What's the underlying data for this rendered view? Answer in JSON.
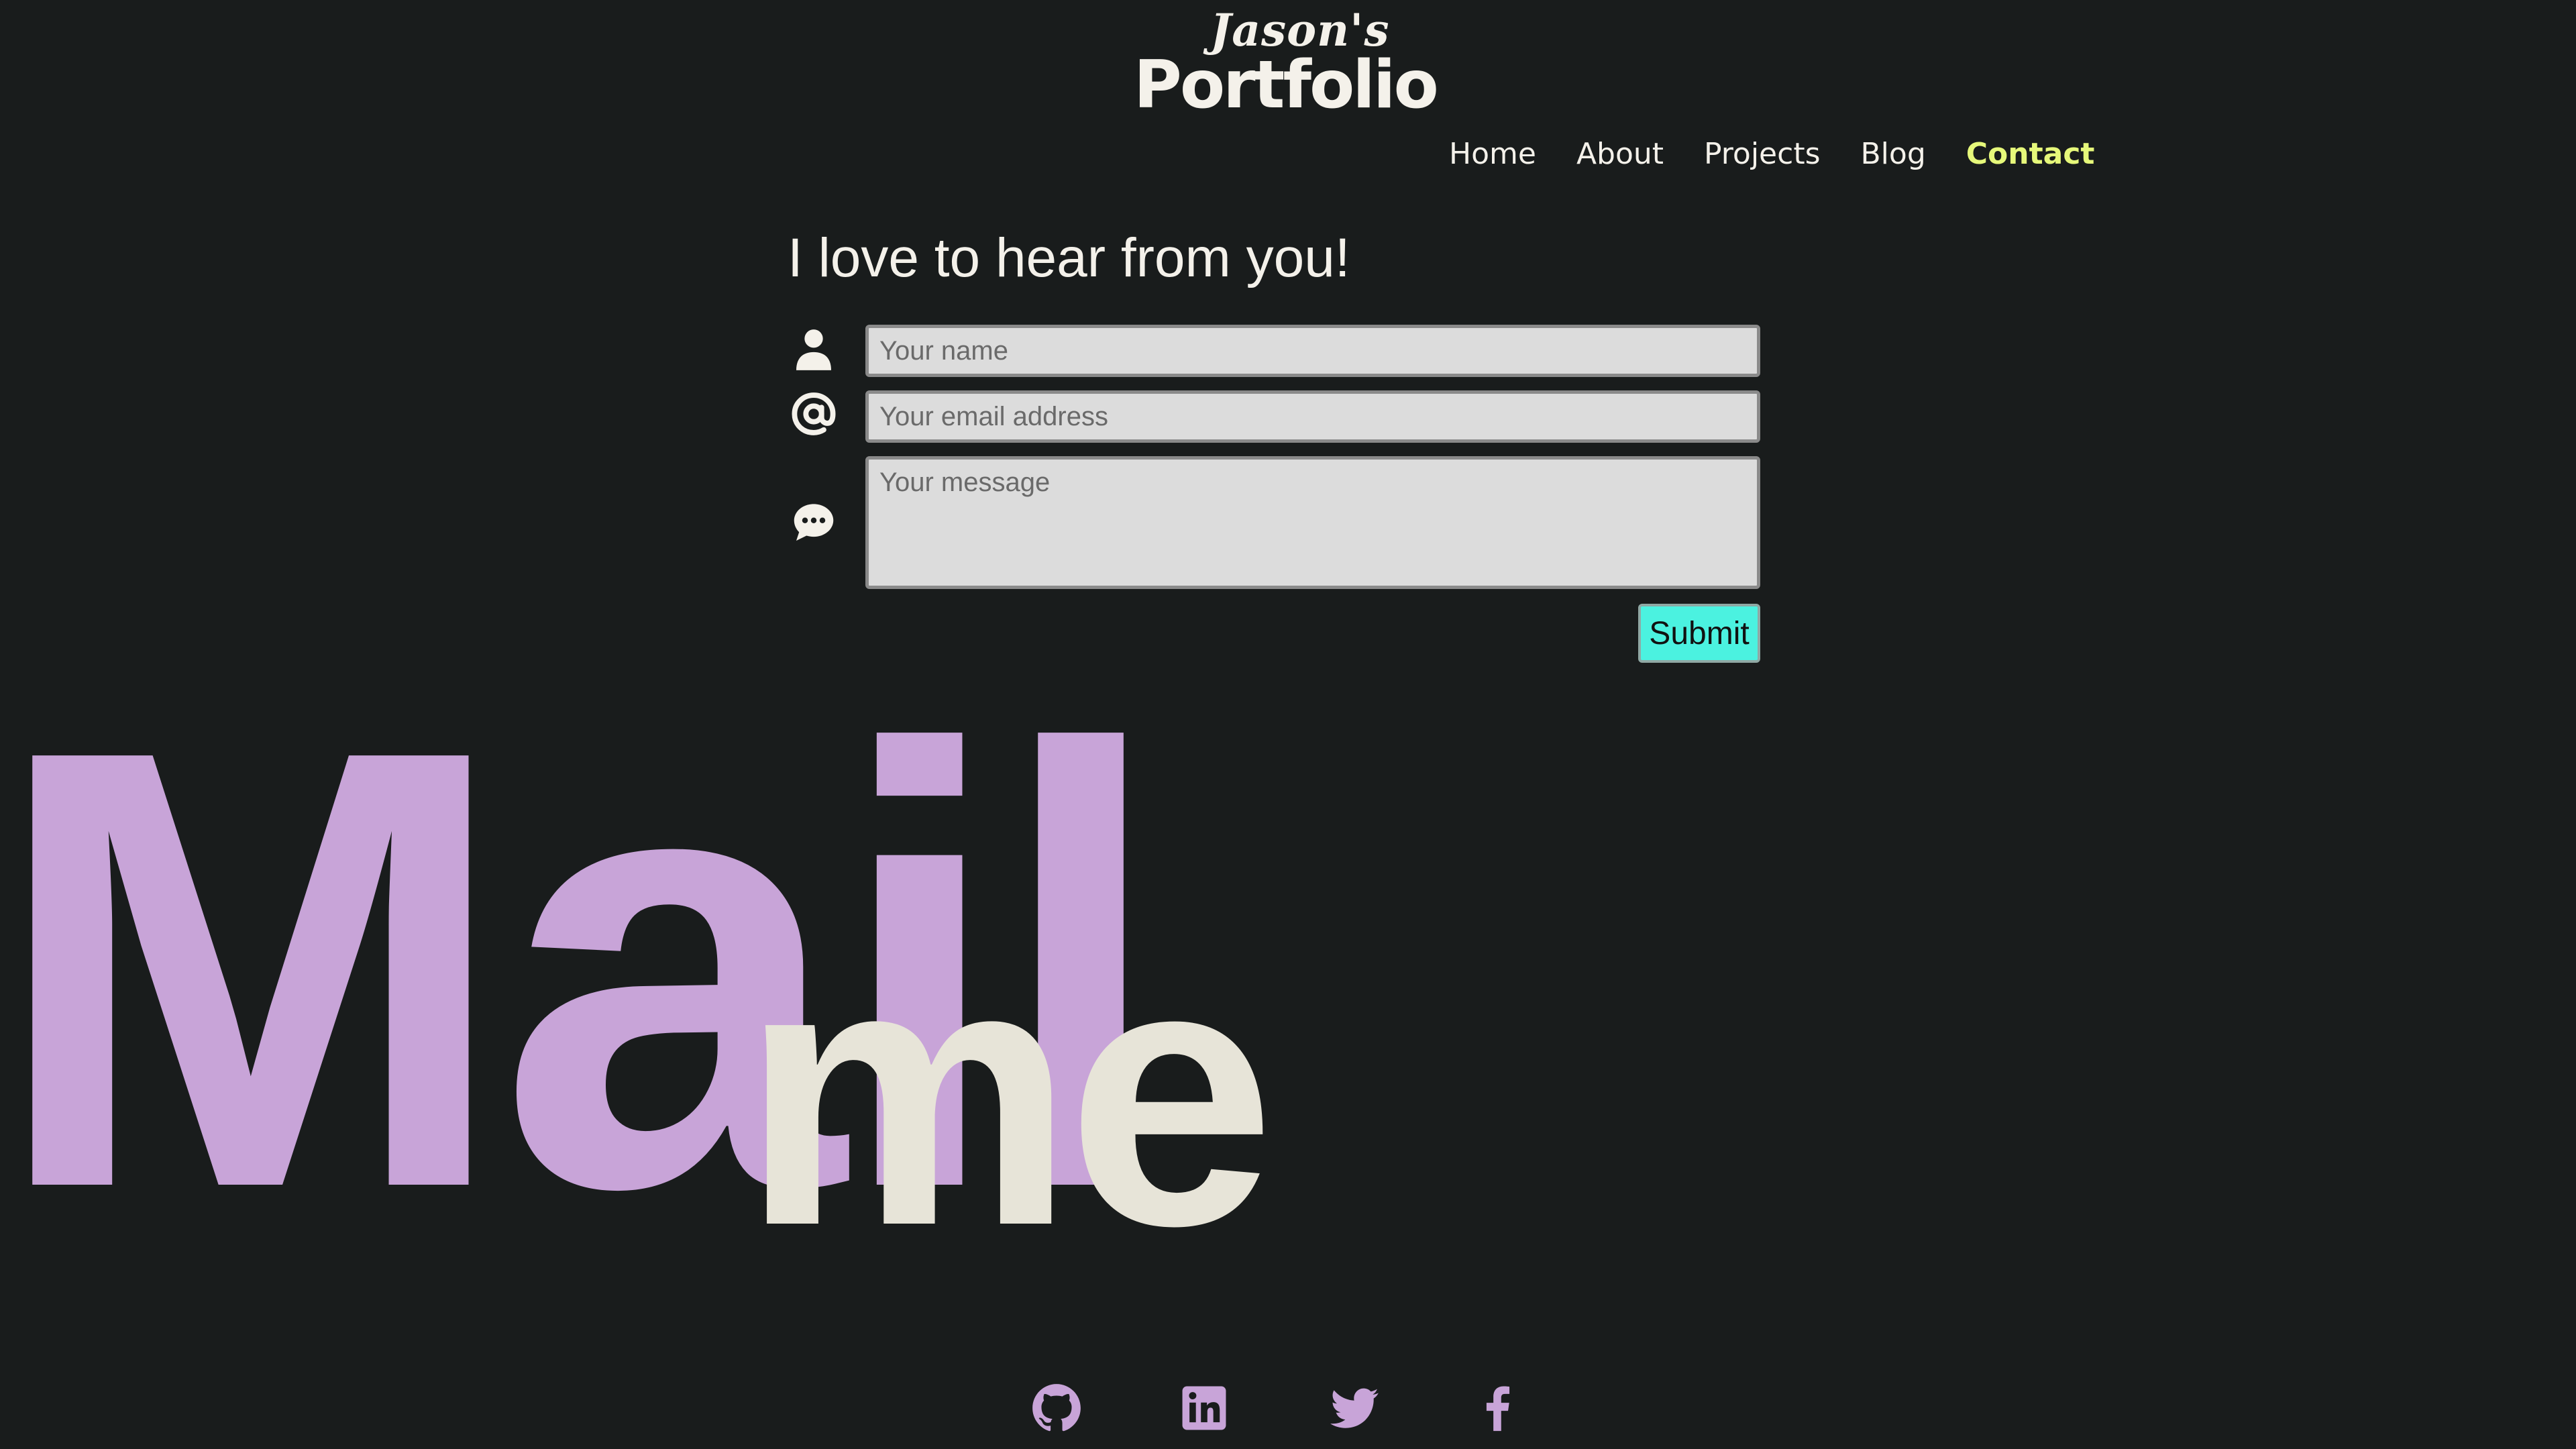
{
  "header": {
    "logo_script": "Jason's",
    "logo_main": "Portfolio"
  },
  "nav": {
    "items": [
      {
        "label": "Home",
        "active": false
      },
      {
        "label": "About",
        "active": false
      },
      {
        "label": "Projects",
        "active": false
      },
      {
        "label": "Blog",
        "active": false
      },
      {
        "label": "Contact",
        "active": true
      }
    ]
  },
  "contact": {
    "heading": "I love to hear from you!",
    "name_placeholder": "Your name",
    "email_placeholder": "Your email address",
    "message_placeholder": "Your message",
    "submit_label": "Submit",
    "icons": [
      "user-icon",
      "at-icon",
      "chat-bubble-icon"
    ]
  },
  "hero": {
    "word_main": "Mail",
    "word_secondary": "me"
  },
  "footer": {
    "social_icons": [
      "github-icon",
      "linkedin-icon",
      "twitter-icon",
      "facebook-icon"
    ]
  },
  "colors": {
    "background": "#191c1c",
    "text": "#f4f1ea",
    "active_nav": "#e6f87a",
    "accent_purple": "#c8a4d8",
    "accent_cream": "#e7e4d8",
    "submit": "#4bf2e0",
    "field": "#dcdcdc"
  }
}
